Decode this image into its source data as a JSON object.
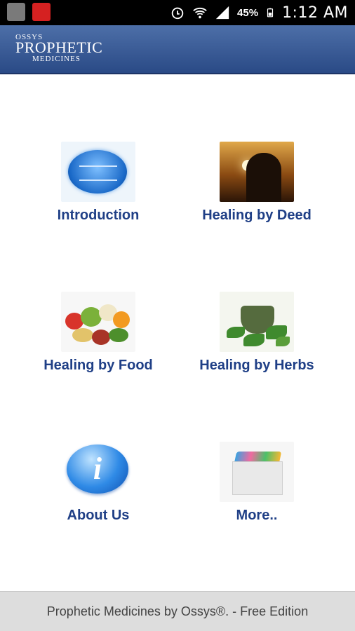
{
  "status_bar": {
    "battery_percent": "45%",
    "time": "1:12 AM",
    "left_icons": [
      "notification-app-icon",
      "notification-store-icon"
    ],
    "right_icons": [
      "alarm-icon",
      "wifi-icon",
      "signal-icon",
      "battery-icon"
    ]
  },
  "header": {
    "logo_line1": "OSSYS",
    "logo_line2": "PROPHETIC",
    "logo_line3": "MEDICINES"
  },
  "menu": [
    {
      "label": "Introduction",
      "icon": "introduction-image"
    },
    {
      "label": "Healing by Deed",
      "icon": "prayer-image"
    },
    {
      "label": "Healing by Food",
      "icon": "vegetables-image"
    },
    {
      "label": "Healing by Herbs",
      "icon": "herbs-image"
    },
    {
      "label": "About Us",
      "icon": "info-icon"
    },
    {
      "label": "More..",
      "icon": "more-box-image"
    }
  ],
  "footer": {
    "text": "Prophetic Medicines by Ossys®. - Free Edition"
  }
}
